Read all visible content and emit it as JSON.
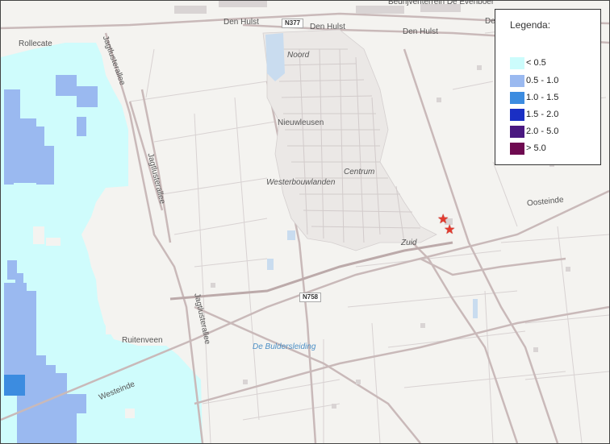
{
  "legend": {
    "title": "Legenda:",
    "items": [
      {
        "label": "< 0.5",
        "color": "#ccfcfc"
      },
      {
        "label": "0.5 - 1.0",
        "color": "#9ab9f0"
      },
      {
        "label": "1.0 - 1.5",
        "color": "#3c8ce0"
      },
      {
        "label": "1.5 - 2.0",
        "color": "#1a2fc4"
      },
      {
        "label": "2.0 - 5.0",
        "color": "#4a1880"
      },
      {
        "label": "> 5.0",
        "color": "#6e0a50"
      }
    ]
  },
  "places": {
    "bedrijventerrein": "Bedrijventerrein De Evenboer",
    "den_hulst_1": "Den Hulst",
    "den_hulst_2": "Den Hulst",
    "den_hulst_3": "Den Hulst",
    "den_edge": "De",
    "rollecate": "Rollecate",
    "noord": "Noord",
    "nieuwleusen": "Nieuwleusen",
    "centrum": "Centrum",
    "westerbouwlanden": "Westerbouwlanden",
    "zuid": "Zuid",
    "ruitenveen": "Ruitenveen",
    "oosteinde": "Oosteinde",
    "westeinde": "Westeinde",
    "jagtlust_1": "Jagtlusterallee",
    "jagtlust_2": "Jagtlusterallee",
    "jagtlust_3": "Jagtlusterallee",
    "buldersleiding": "De Buldersleiding"
  },
  "roads": {
    "n377": "N377",
    "n758": "N758"
  },
  "markers": [
    {
      "name": "star-marker-1",
      "icon": "star-icon",
      "color": "#e23b2e"
    },
    {
      "name": "star-marker-2",
      "icon": "star-icon",
      "color": "#e23b2e"
    }
  ]
}
